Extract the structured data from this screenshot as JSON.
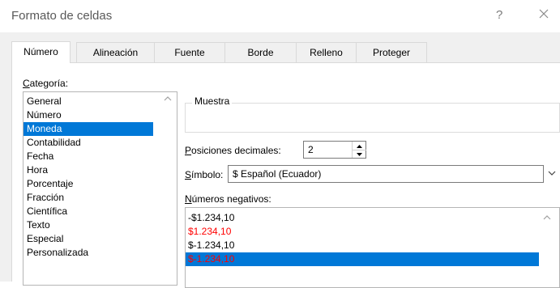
{
  "window": {
    "title": "Formato de celdas",
    "help": "?",
    "close_icon": "close-icon"
  },
  "tabs": [
    {
      "label": "Número",
      "active": true
    },
    {
      "label": "Alineación",
      "active": false
    },
    {
      "label": "Fuente",
      "active": false
    },
    {
      "label": "Borde",
      "active": false
    },
    {
      "label": "Relleno",
      "active": false
    },
    {
      "label": "Proteger",
      "active": false
    }
  ],
  "categoria": {
    "label_first": "C",
    "label_rest": "ategoría:",
    "items": [
      "General",
      "Número",
      "Moneda",
      "Contabilidad",
      "Fecha",
      "Hora",
      "Porcentaje",
      "Fracción",
      "Científica",
      "Texto",
      "Especial",
      "Personalizada"
    ],
    "selected": "Moneda"
  },
  "muestra": {
    "label": "Muestra"
  },
  "decimales": {
    "label_first": "P",
    "label_rest": "osiciones decimales:",
    "value": "2"
  },
  "simbolo": {
    "label_first": "S",
    "label_rest": "ímbolo:",
    "value": "$ Español (Ecuador)"
  },
  "negativos": {
    "label_first": "N",
    "label_rest": "úmeros negativos:",
    "items": [
      {
        "text": "-$1.234,10",
        "red": false
      },
      {
        "text": "$1.234,10",
        "red": true
      },
      {
        "text": "$-1.234,10",
        "red": false
      },
      {
        "text": "$-1.234,10",
        "red": true
      }
    ],
    "selected_index": 3
  },
  "colors": {
    "selection": "#0078d7",
    "negative_red": "#ff0000",
    "dialog_bg": "#f0f0f0"
  }
}
